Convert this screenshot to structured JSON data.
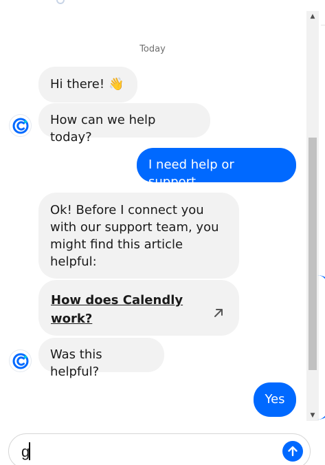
{
  "chat": {
    "date_label": "Today",
    "messages": [
      {
        "sender": "bot",
        "text": "Hi there!"
      },
      {
        "sender": "bot",
        "text": "How can we help today?"
      },
      {
        "sender": "user",
        "text": "I need help or support"
      },
      {
        "sender": "bot",
        "text": "Ok! Before I connect you with our support team, you might find this article helpful:"
      },
      {
        "sender": "bot",
        "link_text": "How does Calendly work?"
      },
      {
        "sender": "bot",
        "text": "Was this helpful?"
      },
      {
        "sender": "user",
        "text": "Yes"
      }
    ],
    "wave_emoji": "👋"
  },
  "composer": {
    "input_value": "g"
  },
  "colors": {
    "user_bubble": "#0069ff",
    "bot_bubble": "#f2f2f2",
    "accent": "#0069ff"
  },
  "icons": {
    "avatar": "calendly-logo-icon",
    "link": "external-link-arrow-icon",
    "send": "arrow-up-icon",
    "scroll_up": "scroll-up-arrow-icon",
    "scroll_down": "scroll-down-arrow-icon"
  }
}
